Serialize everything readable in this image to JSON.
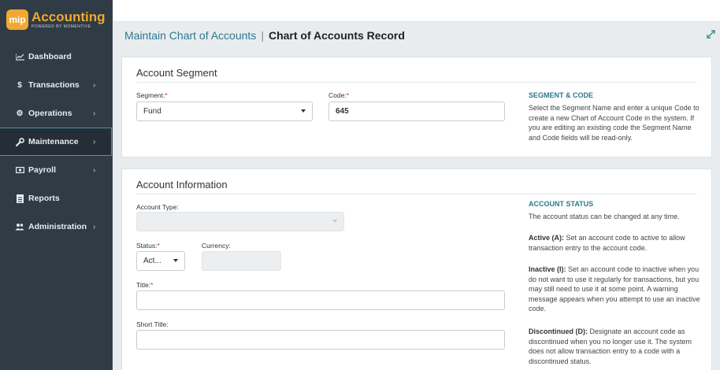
{
  "app": {
    "logo_badge": "mip",
    "logo_title": "Accounting",
    "logo_sub": "POWERED BY MOMENTIVE",
    "brand_color": "#f0a830"
  },
  "sidebar": {
    "items": [
      {
        "label": "Dashboard",
        "icon": "chart-line-icon",
        "chevron": ""
      },
      {
        "label": "Transactions",
        "icon": "dollar-icon",
        "chevron": "›"
      },
      {
        "label": "Operations",
        "icon": "gears-icon",
        "chevron": "›"
      },
      {
        "label": "Maintenance",
        "icon": "wrench-icon",
        "chevron": "›"
      },
      {
        "label": "Payroll",
        "icon": "money-icon",
        "chevron": "›"
      },
      {
        "label": "Reports",
        "icon": "document-icon",
        "chevron": ""
      },
      {
        "label": "Administration",
        "icon": "users-icon",
        "chevron": "›"
      }
    ],
    "active": "Maintenance"
  },
  "header": {
    "breadcrumb": "Maintain Chart of Accounts",
    "separator": "|",
    "title": "Chart of Accounts Record"
  },
  "segment_card": {
    "title": "Account Segment",
    "segment_label": "Segment:",
    "segment_required": "*",
    "segment_value": "Fund",
    "code_label": "Code:",
    "code_required": "*",
    "code_value": "645",
    "help_title": "SEGMENT & CODE",
    "help_text": "Select the Segment Name and enter a unique Code to create a new Chart of Account Code in the system. If you are editing an existing code the Segment Name and Code fields will be read-only."
  },
  "info_card": {
    "title": "Account Information",
    "account_type_label": "Account Type:",
    "account_type_value": "",
    "status_label": "Status:",
    "status_required": "*",
    "status_value": "Act...",
    "currency_label": "Currency:",
    "currency_value": "",
    "title_label": "Title:",
    "title_required": "*",
    "title_value": "",
    "short_title_label": "Short Title:",
    "short_title_value": "",
    "help_title": "ACCOUNT STATUS",
    "help_intro": "The account status can be changed at any time.",
    "help_active_head": "Active (A):",
    "help_active_text": " Set an account code to active to allow transaction entry to the account code.",
    "help_inactive_head": "Inactive (I):",
    "help_inactive_text": " Set an account code to inactive when you do not want to use it regularly for transactions, but you may still need to use it at some point. A warning message appears when you attempt to use an inactive code.",
    "help_discontinued_head": "Discontinued (D):",
    "help_discontinued_text": " Designate an account code as discontinued when you no longer use it. The system does not allow transaction entry to a code with a discontinued status."
  },
  "colors": {
    "sidebar_bg": "#2f3b45",
    "accent": "#2b7a8c",
    "required": "#c0392b"
  }
}
